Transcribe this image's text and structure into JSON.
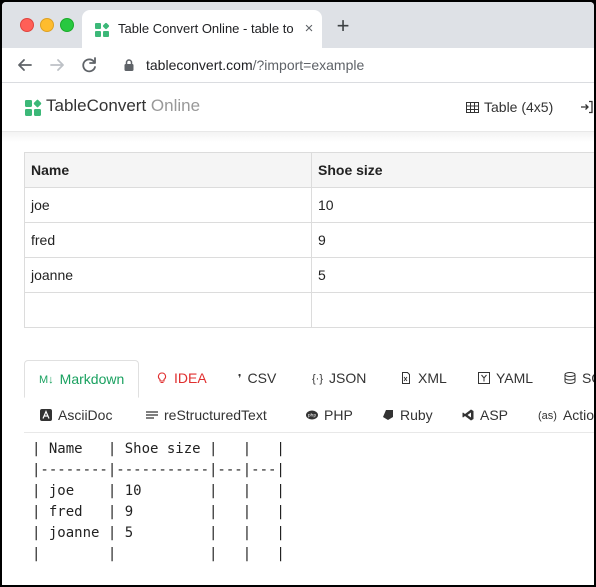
{
  "browser": {
    "tab_title": "Table Convert Online - table to",
    "tab_close": "×",
    "new_tab": "+",
    "url_host": "tableconvert.com",
    "url_path": "/?import=example"
  },
  "header": {
    "brand": "TableConvert",
    "brand_sub": "Online",
    "table_indicator": "Table (4x5)"
  },
  "table": {
    "headers": [
      "Name",
      "Shoe size"
    ],
    "rows": [
      [
        "joe",
        "10"
      ],
      [
        "fred",
        "9"
      ],
      [
        "joanne",
        "5"
      ],
      [
        "",
        ""
      ]
    ]
  },
  "formats": {
    "row1": [
      "Markdown",
      "IDEA",
      "CSV",
      "JSON",
      "XML",
      "YAML",
      "SQ"
    ],
    "row2": [
      "AsciiDoc",
      "reStructuredText",
      "PHP",
      "Ruby",
      "ASP",
      "Action"
    ],
    "active": "Markdown"
  },
  "output": {
    "lines": [
      "| Name   | Shoe size |   |   |",
      "|--------|-----------|---|---|",
      "| joe    | 10        |   |   |",
      "| fred   | 9         |   |   |",
      "| joanne | 5         |   |   |",
      "|        |           |   |   |"
    ]
  },
  "colors": {
    "accent": "#1aa160",
    "idea": "#e02f2f",
    "logo": "#3cb878"
  }
}
